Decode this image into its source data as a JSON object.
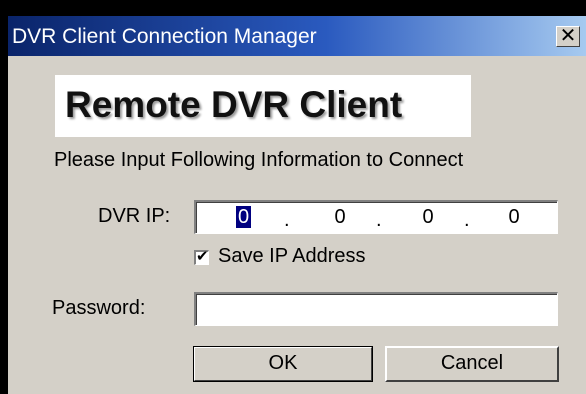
{
  "window": {
    "title": "DVR Client Connection Manager",
    "close_glyph": "✕"
  },
  "banner": {
    "text": "Remote DVR Client"
  },
  "instruction": "Please Input Following Information to Connect",
  "ip": {
    "label": "DVR IP:",
    "octets": [
      "0",
      "0",
      "0",
      "0"
    ],
    "separator": "."
  },
  "save_ip": {
    "label": "Save IP Address",
    "checked": true,
    "check_glyph": "✔"
  },
  "password": {
    "label": "Password:",
    "value": ""
  },
  "buttons": {
    "ok": "OK",
    "cancel": "Cancel"
  },
  "colors": {
    "title_start": "#0a246a",
    "title_end": "#a6caf0",
    "face": "#d4d0c8",
    "selection": "#000080"
  },
  "icons": [
    "close-icon",
    "checkmark-icon"
  ]
}
